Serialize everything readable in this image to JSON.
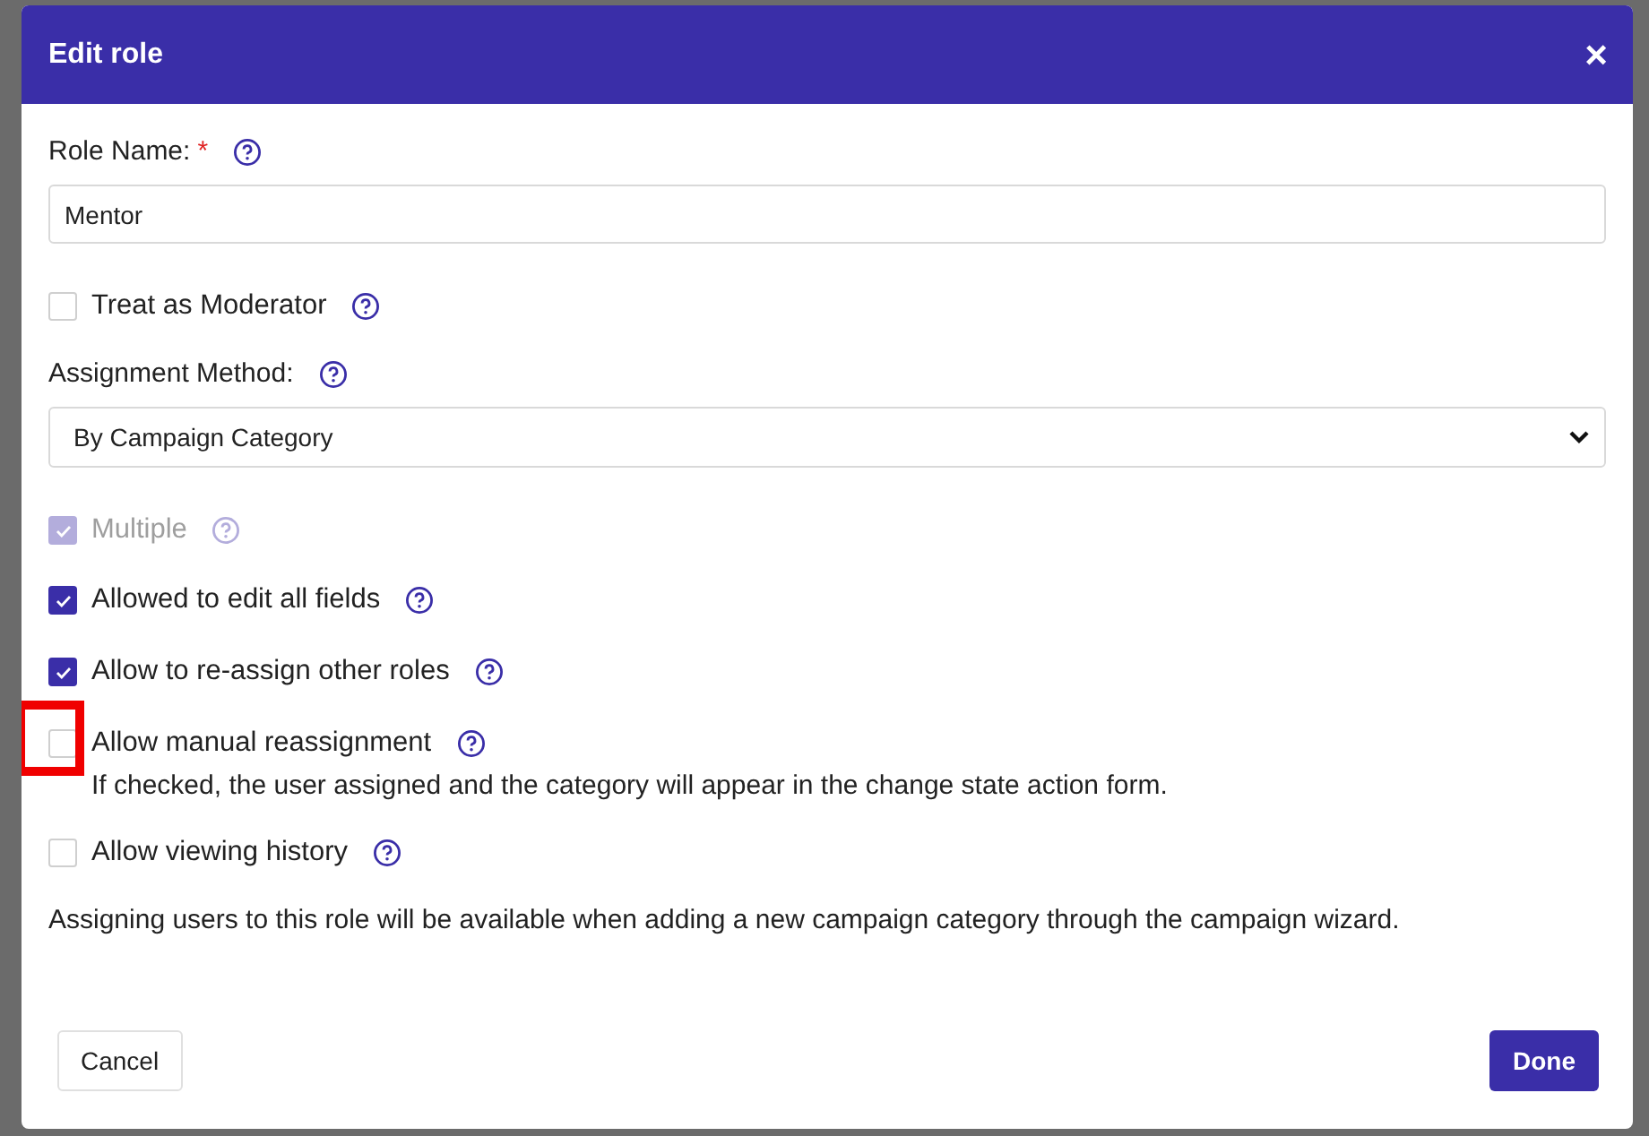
{
  "dialog": {
    "title": "Edit role",
    "close": "×"
  },
  "fields": [
    {
      "kind": "text",
      "label": "Role Name:",
      "required_mark": "*",
      "value": "Mentor"
    },
    {
      "kind": "checkbox",
      "label": "Treat as Moderator",
      "checked": false,
      "disabled": false,
      "highlighted": false
    },
    {
      "kind": "select",
      "label": "Assignment Method:",
      "value": "By Campaign Category"
    },
    {
      "kind": "checkbox",
      "label": "Multiple",
      "checked": true,
      "disabled": true,
      "highlighted": false
    },
    {
      "kind": "checkbox",
      "label": "Allowed to edit all fields",
      "checked": true,
      "disabled": false,
      "highlighted": false
    },
    {
      "kind": "checkbox",
      "label": "Allow to re-assign other roles",
      "checked": true,
      "disabled": false,
      "highlighted": false
    },
    {
      "kind": "checkbox",
      "label": "Allow manual reassignment",
      "checked": false,
      "disabled": false,
      "highlighted": true,
      "note": "If checked, the user assigned and the category will appear in the change state action form."
    },
    {
      "kind": "checkbox",
      "label": "Allow viewing history",
      "checked": false,
      "disabled": false,
      "highlighted": false
    }
  ],
  "footnote": "Assigning users to this role will be available when adding a new campaign category through the campaign wizard.",
  "buttons": {
    "cancel": "Cancel",
    "done": "Done"
  }
}
